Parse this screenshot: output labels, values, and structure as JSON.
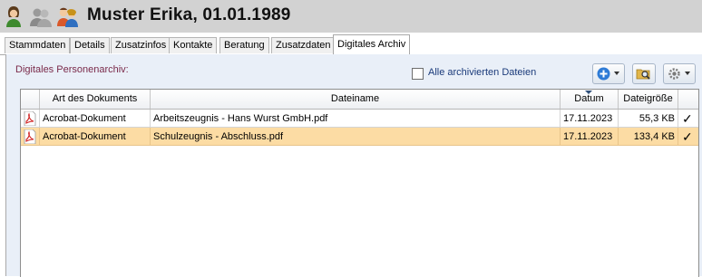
{
  "header": {
    "title": "Muster Erika, 01.01.1989",
    "icons": [
      "person-female-icon",
      "persons-group-icon",
      "person-pair-icon"
    ]
  },
  "tabs": [
    {
      "label": "Stammdaten",
      "active": false
    },
    {
      "label": "Details",
      "active": false
    },
    {
      "label": "Zusatzinfos",
      "active": false
    },
    {
      "label": "Kontakte",
      "active": false
    },
    {
      "label": "Beratung",
      "active": false
    },
    {
      "label": "Zusatzdaten",
      "active": false
    },
    {
      "label": "Digitales Archiv",
      "active": true
    }
  ],
  "archive": {
    "section_label": "Digitales Personenarchiv:",
    "show_all_label": "Alle archivierten Dateien",
    "show_all_checked": false,
    "toolbar": [
      "add-dropdown-icon",
      "search-folder-icon",
      "settings-dropdown-icon"
    ]
  },
  "table": {
    "columns": [
      "Art des Dokuments",
      "Dateiname",
      "Datum",
      "Dateigröße",
      ""
    ],
    "sort_column": "Datum",
    "rows": [
      {
        "type": "Acrobat-Dokument",
        "filename": "Arbeitszeugnis - Hans Wurst GmbH.pdf",
        "date": "17.11.2023",
        "size": "55,3 KB",
        "check": "✓",
        "selected": false
      },
      {
        "type": "Acrobat-Dokument",
        "filename": "Schulzeugnis - Abschluss.pdf",
        "date": "17.11.2023",
        "size": "133,4 KB",
        "check": "✓",
        "selected": true
      }
    ]
  },
  "colors": {
    "header_bg": "#d2d2d2",
    "panel_bg": "#e9eff8",
    "selection": "#fcdca4",
    "section_label": "#7a2a4a"
  }
}
